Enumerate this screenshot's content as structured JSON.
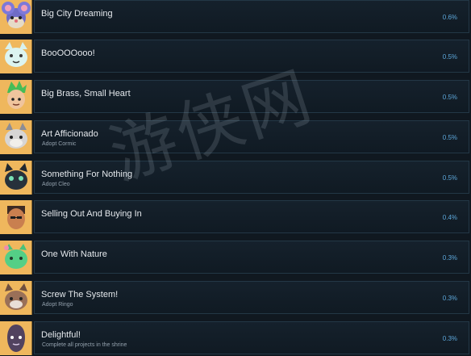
{
  "achievements": [
    {
      "title": "Big City Dreaming",
      "description": "",
      "percent": "0.6%",
      "icon": "mouse-portrait-icon",
      "bg": "#f0b95e"
    },
    {
      "title": "BooOOOooo!",
      "description": "",
      "percent": "0.5%",
      "icon": "ghost-cat-portrait-icon",
      "bg": "#f0b95e"
    },
    {
      "title": "Big Brass, Small Heart",
      "description": "",
      "percent": "0.5%",
      "icon": "green-hair-kid-portrait-icon",
      "bg": "#f0b95e"
    },
    {
      "title": "Art Afficionado",
      "description": "Adopt Cormic",
      "percent": "0.5%",
      "icon": "gray-cat-portrait-icon",
      "bg": "#f0b95e"
    },
    {
      "title": "Something For Nothing",
      "description": "Adopt Cleo",
      "percent": "0.5%",
      "icon": "black-cat-portrait-icon",
      "bg": "#f0b95e"
    },
    {
      "title": "Selling Out And Buying In",
      "description": "",
      "percent": "0.4%",
      "icon": "businessman-portrait-icon",
      "bg": "#f0b95e"
    },
    {
      "title": "One With Nature",
      "description": "",
      "percent": "0.3%",
      "icon": "green-cat-portrait-icon",
      "bg": "#f0b95e"
    },
    {
      "title": "Screw The System!",
      "description": "Adopt Ringo",
      "percent": "0.3%",
      "icon": "brown-cat-portrait-icon",
      "bg": "#f0b95e"
    },
    {
      "title": "Delightful!",
      "description": "Complete all projects in the shrine",
      "percent": "0.3%",
      "icon": "purple-creature-portrait-icon",
      "bg": "#f0b95e"
    }
  ],
  "watermark": "游侠网",
  "colors": {
    "background": "#101820",
    "panel_border": "#233746",
    "title": "#e4e8ec",
    "description": "#94a1ad",
    "percent": "#5da7da"
  }
}
